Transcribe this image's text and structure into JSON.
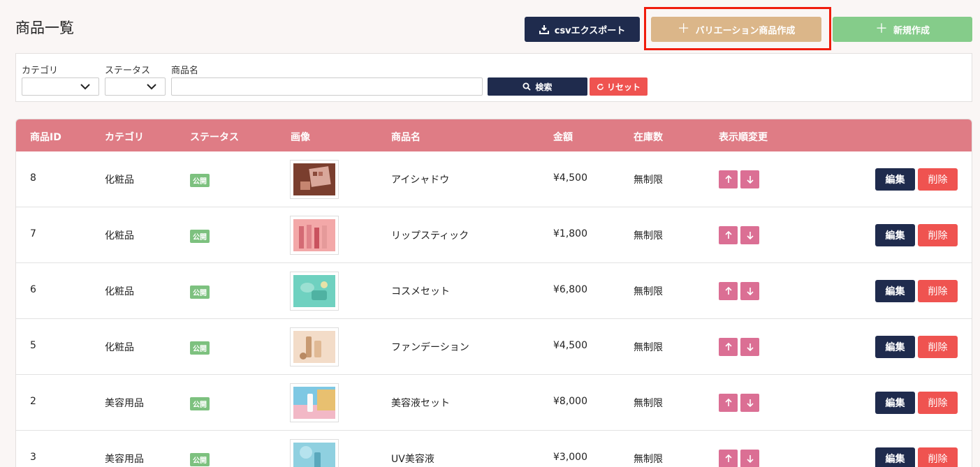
{
  "page": {
    "title": "商品一覧"
  },
  "toolbar": {
    "export_label": "csvエクスポート",
    "variation_label": "バリエーション商品作成",
    "new_label": "新規作成"
  },
  "filters": {
    "category_label": "カテゴリ",
    "category_value": "",
    "status_label": "ステータス",
    "status_value": "",
    "name_label": "商品名",
    "name_value": "",
    "search_label": "検索",
    "reset_label": "リセット"
  },
  "table": {
    "headers": [
      "商品ID",
      "カテゴリ",
      "ステータス",
      "画像",
      "商品名",
      "金額",
      "在庫数",
      "表示順変更"
    ],
    "edit_label": "編集",
    "delete_label": "削除",
    "rows": [
      {
        "id": "8",
        "category": "化粧品",
        "status": "公開",
        "name": "アイシャドウ",
        "price": "¥4,500",
        "stock": "無制限"
      },
      {
        "id": "7",
        "category": "化粧品",
        "status": "公開",
        "name": "リップスティック",
        "price": "¥1,800",
        "stock": "無制限"
      },
      {
        "id": "6",
        "category": "化粧品",
        "status": "公開",
        "name": "コスメセット",
        "price": "¥6,800",
        "stock": "無制限"
      },
      {
        "id": "5",
        "category": "化粧品",
        "status": "公開",
        "name": "ファンデーション",
        "price": "¥4,500",
        "stock": "無制限"
      },
      {
        "id": "2",
        "category": "美容用品",
        "status": "公開",
        "name": "美容液セット",
        "price": "¥8,000",
        "stock": "無制限"
      },
      {
        "id": "3",
        "category": "美容用品",
        "status": "公開",
        "name": "UV美容液",
        "price": "¥3,000",
        "stock": "無制限"
      }
    ]
  },
  "colors": {
    "navy": "#1f2b4d",
    "variation": "#dbb689",
    "new": "#85cc8a",
    "header": "#df7c85",
    "danger": "#ef5350",
    "arrow": "#db6f94",
    "badge": "#7dc17f",
    "highlight": "#f01c0c"
  }
}
